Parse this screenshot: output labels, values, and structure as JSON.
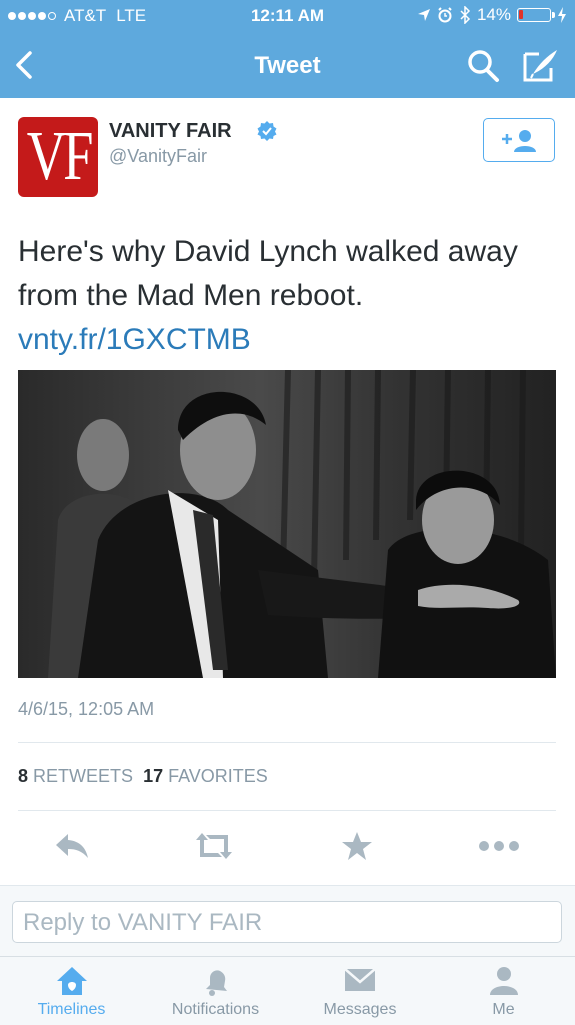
{
  "status_bar": {
    "carrier": "AT&T",
    "network": "LTE",
    "time": "12:11 AM",
    "battery_percent": "14%",
    "battery_level": 0.14
  },
  "nav": {
    "title": "Tweet",
    "icons": [
      "back-icon",
      "search-icon",
      "compose-icon"
    ]
  },
  "tweet": {
    "author": {
      "name": "VANITY FAIR",
      "handle": "@VanityFair",
      "verified": true,
      "avatar_text": "VF"
    },
    "text": "Here's why David Lynch walked away from the Mad Men reboot. ",
    "link": "vnty.fr/1GXCTMB",
    "timestamp": "4/6/15, 12:05 AM",
    "retweets_count": "8",
    "retweets_label": "RETWEETS",
    "favorites_count": "17",
    "favorites_label": "FAVORITES"
  },
  "actions": [
    "reply-icon",
    "retweet-icon",
    "favorite-icon",
    "more-icon"
  ],
  "reply": {
    "placeholder": "Reply to VANITY FAIR"
  },
  "tabs": [
    {
      "label": "Timelines",
      "icon": "home-icon",
      "active": true
    },
    {
      "label": "Notifications",
      "icon": "bell-icon",
      "active": false
    },
    {
      "label": "Messages",
      "icon": "envelope-icon",
      "active": false
    },
    {
      "label": "Me",
      "icon": "person-icon",
      "active": false
    }
  ],
  "colors": {
    "header": "#5ea9dd",
    "accent": "#55acee",
    "link": "#2b7bb9",
    "muted": "#8899a6",
    "avatar": "#c41a1a",
    "battery_low": "#e0332a"
  }
}
